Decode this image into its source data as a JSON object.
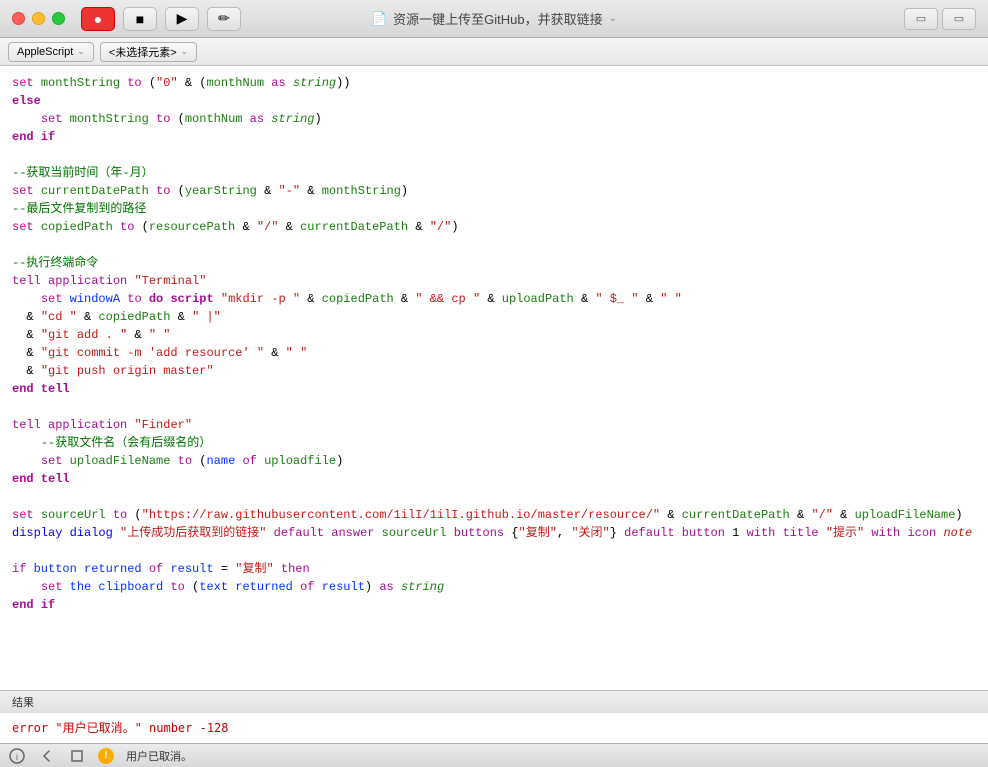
{
  "titleBar": {
    "title": "资源一键上传至GitHub，并获取链接",
    "docIcon": "📄",
    "dropdownIcon": "⌄"
  },
  "toolbar": {
    "buttons": [
      {
        "id": "record",
        "label": "●",
        "active": true
      },
      {
        "id": "stop",
        "label": "■",
        "active": false
      },
      {
        "id": "run",
        "label": "▶",
        "active": false
      },
      {
        "id": "compile",
        "label": "✏",
        "active": false
      }
    ]
  },
  "selectors": {
    "language": "AppleScript",
    "element": "<未选择元素>"
  },
  "code": [
    {
      "id": 1,
      "content": "set monthString to (\"0\" & (monthNum as string))"
    },
    {
      "id": 2,
      "content": "else"
    },
    {
      "id": 3,
      "content": "    set monthString to (monthNum as string)"
    },
    {
      "id": 4,
      "content": "end if"
    },
    {
      "id": 5,
      "content": ""
    },
    {
      "id": 6,
      "content": "--获取当前时间（年-月）"
    },
    {
      "id": 7,
      "content": "set currentDatePath to (yearString & \"-\" & monthString)"
    },
    {
      "id": 8,
      "content": "--最后文件复制到的路径"
    },
    {
      "id": 9,
      "content": "set copiedPath to (resourcePath & \"/\" & currentDatePath & \"/\")"
    },
    {
      "id": 10,
      "content": ""
    },
    {
      "id": 11,
      "content": "--执行终端命令"
    },
    {
      "id": 12,
      "content": "tell application \"Terminal\""
    },
    {
      "id": 13,
      "content": "    set windowA to do script \"mkdir -p \" & copiedPath & \" && cp \" & uploadPath & \" $_ \" & \" \""
    },
    {
      "id": 14,
      "content": "  & \"cd \" & copiedPath & \" \""
    },
    {
      "id": 15,
      "content": "  & \"git add . \" & \" \""
    },
    {
      "id": 16,
      "content": "  & \"git commit -m 'add resource' \" & \" \""
    },
    {
      "id": 17,
      "content": "  & \"git push origin master\""
    },
    {
      "id": 18,
      "content": "end tell"
    },
    {
      "id": 19,
      "content": ""
    },
    {
      "id": 20,
      "content": "tell application \"Finder\""
    },
    {
      "id": 21,
      "content": "    --获取文件名（会有后缀名的）"
    },
    {
      "id": 22,
      "content": "    set uploadFileName to (name of uploadfile)"
    },
    {
      "id": 23,
      "content": "end tell"
    },
    {
      "id": 24,
      "content": ""
    },
    {
      "id": 25,
      "content": "set sourceUrl to (\"https://raw.githubusercontent.com/1ilI/1ilI.github.io/master/resource/\" & currentDatePath & \"/\" & uploadFileName)"
    },
    {
      "id": 26,
      "content": "display dialog \"上传成功后获取到的链接\" default answer sourceUrl buttons {\"复制\", \"关闭\"} default button 1 with title \"提示\" with icon note"
    },
    {
      "id": 27,
      "content": ""
    },
    {
      "id": 28,
      "content": "if button returned of result = \"复制\" then"
    },
    {
      "id": 29,
      "content": "    set the clipboard to (text returned of result) as string"
    },
    {
      "id": 30,
      "content": "end if"
    }
  ],
  "resultsHeader": "结果",
  "resultsContent": "error \"用户已取消。\" number -128",
  "statusBar": {
    "statusText": "用户已取消。",
    "icons": [
      "info",
      "back",
      "stop",
      "warning"
    ]
  }
}
